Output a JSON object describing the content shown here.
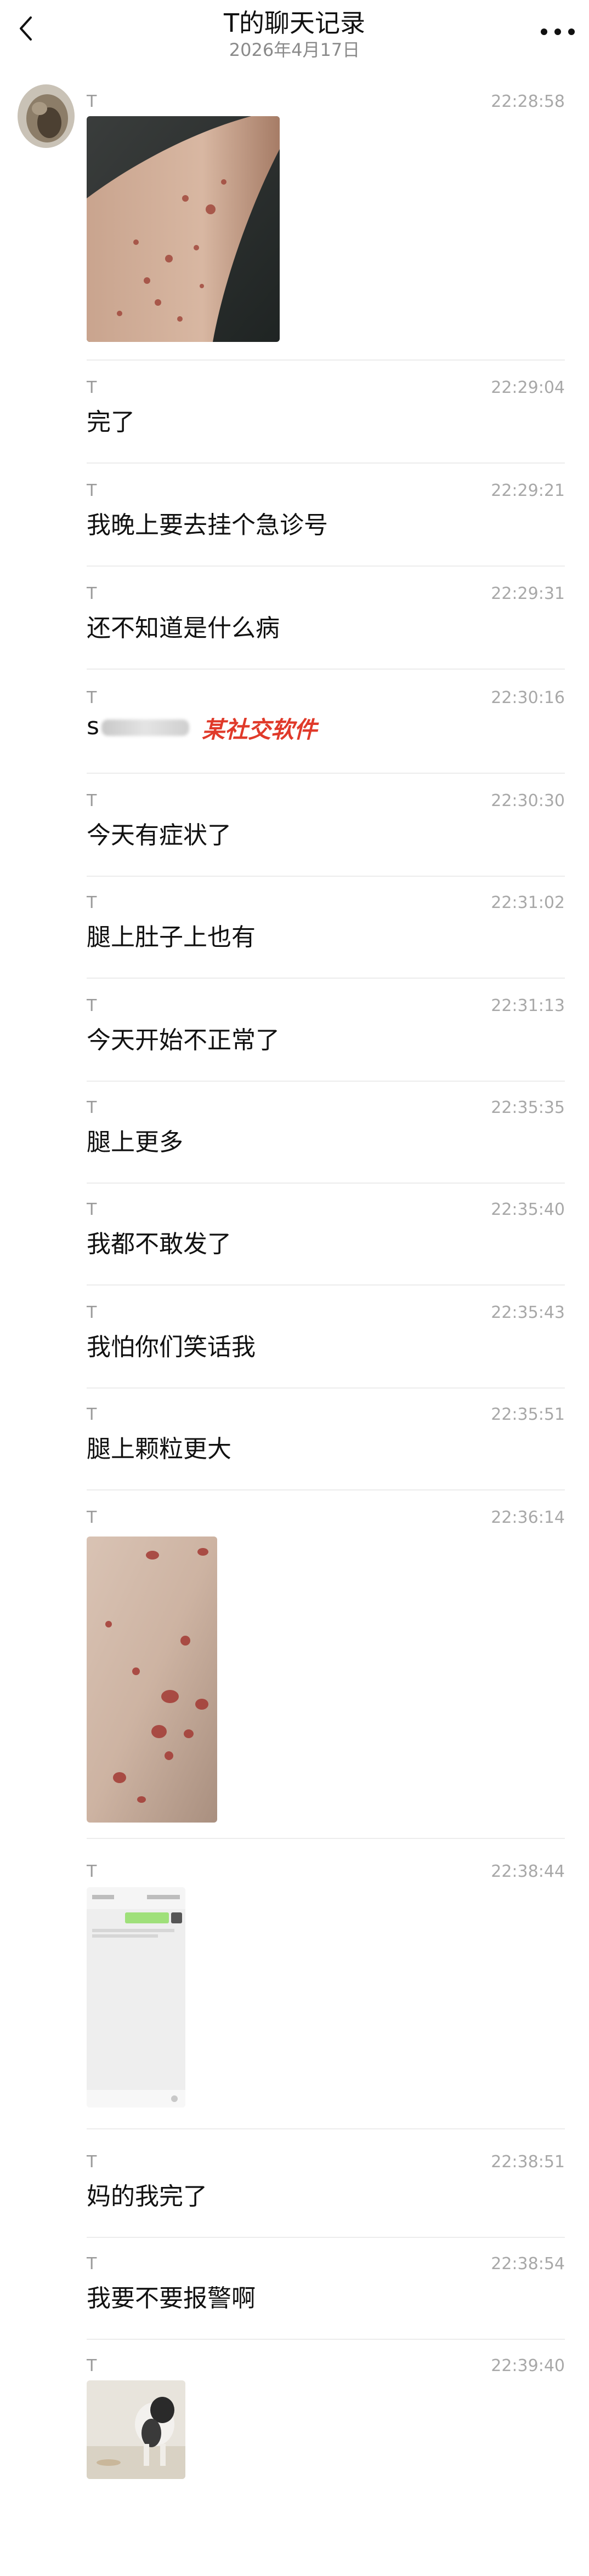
{
  "header": {
    "title": "T的聊天记录",
    "date": "2026年4月17日"
  },
  "messages": [
    {
      "sender": "T",
      "time": "22:28:58",
      "type": "image",
      "image": "arm-rash-photo"
    },
    {
      "sender": "T",
      "time": "22:29:04",
      "type": "text",
      "text": "完了"
    },
    {
      "sender": "T",
      "time": "22:29:21",
      "type": "text",
      "text": "我晚上要去挂个急诊号"
    },
    {
      "sender": "T",
      "time": "22:29:31",
      "type": "text",
      "text": "还不知道是什么病"
    },
    {
      "sender": "T",
      "time": "22:30:16",
      "type": "text",
      "text": "s",
      "watermark": "某社交软件"
    },
    {
      "sender": "T",
      "time": "22:30:30",
      "type": "text",
      "text": "今天有症状了"
    },
    {
      "sender": "T",
      "time": "22:31:02",
      "type": "text",
      "text": "腿上肚子上也有"
    },
    {
      "sender": "T",
      "time": "22:31:13",
      "type": "text",
      "text": "今天开始不正常了"
    },
    {
      "sender": "T",
      "time": "22:35:35",
      "type": "text",
      "text": "腿上更多"
    },
    {
      "sender": "T",
      "time": "22:35:40",
      "type": "text",
      "text": "我都不敢发了"
    },
    {
      "sender": "T",
      "time": "22:35:43",
      "type": "text",
      "text": "我怕你们笑话我"
    },
    {
      "sender": "T",
      "time": "22:35:51",
      "type": "text",
      "text": "腿上颗粒更大"
    },
    {
      "sender": "T",
      "time": "22:36:14",
      "type": "image",
      "image": "leg-rash-photo"
    },
    {
      "sender": "T",
      "time": "22:38:44",
      "type": "image",
      "image": "chat-screenshot"
    },
    {
      "sender": "T",
      "time": "22:38:51",
      "type": "text",
      "text": "妈的我完了"
    },
    {
      "sender": "T",
      "time": "22:38:54",
      "type": "text",
      "text": "我要不要报警啊"
    },
    {
      "sender": "T",
      "time": "22:39:40",
      "type": "image",
      "image": "dog-photo"
    }
  ],
  "colors": {
    "watermark": "#e03a2a",
    "timestamp": "#a8a8a8",
    "divider": "#ececec"
  },
  "icons": [
    "back-chevron-icon",
    "more-dots-icon"
  ]
}
